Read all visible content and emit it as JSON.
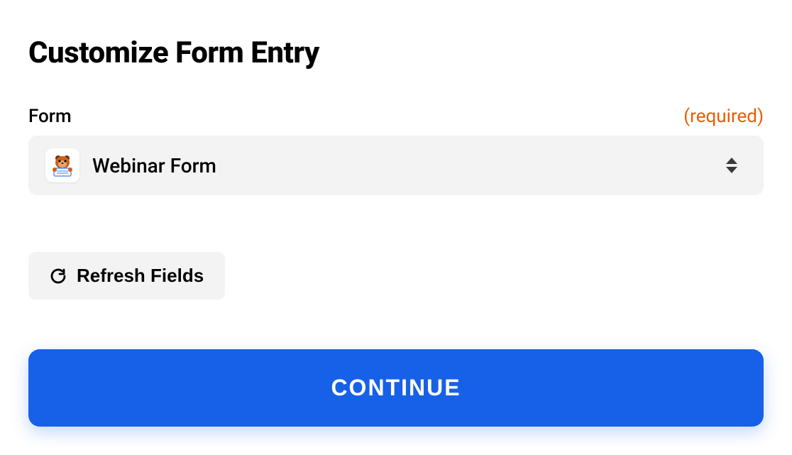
{
  "title": "Customize Form Entry",
  "form": {
    "label": "Form",
    "required_tag": "(required)",
    "selected_value": "Webinar Form",
    "app_icon_name": "wpforms-bear-icon"
  },
  "refresh_button": {
    "label": "Refresh Fields"
  },
  "continue_button": {
    "label": "CONTINUE"
  }
}
